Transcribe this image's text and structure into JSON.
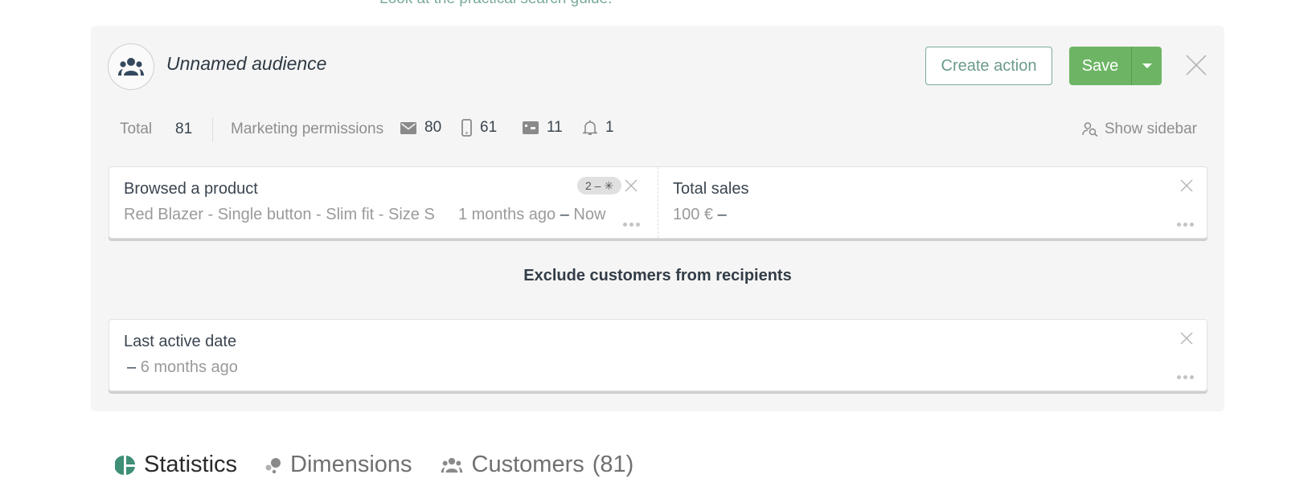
{
  "top_link": "Look at the practical search guide.",
  "header": {
    "title": "Unnamed audience",
    "avatar_icon": "group-icon",
    "create_action_label": "Create action",
    "save_label": "Save"
  },
  "stats": {
    "total_label": "Total",
    "total_value": "81",
    "permissions_label": "Marketing permissions",
    "permissions": [
      {
        "icon": "email-icon",
        "value": "80"
      },
      {
        "icon": "mobile-icon",
        "value": "61"
      },
      {
        "icon": "mailbox-icon",
        "value": "11"
      },
      {
        "icon": "bell-icon",
        "value": "1"
      }
    ],
    "show_sidebar_label": "Show sidebar"
  },
  "include_conditions": [
    {
      "title": "Browsed a product",
      "detail": "Red Blazer - Single button - Slim fit - Size S",
      "range_from": "1 months ago",
      "range_to": "Now",
      "badge": "2 – ✳"
    },
    {
      "title": "Total sales",
      "range_from": "100 €",
      "range_to": ""
    }
  ],
  "exclude_heading": "Exclude customers from recipients",
  "exclude_conditions": [
    {
      "title": "Last active date",
      "range_from": "",
      "range_to": "6 months ago"
    }
  ],
  "tabs": [
    {
      "label": "Statistics",
      "icon": "pie-chart-icon",
      "active": true
    },
    {
      "label": "Dimensions",
      "icon": "bubbles-icon",
      "active": false
    },
    {
      "label": "Customers",
      "count": "(81)",
      "icon": "group-icon",
      "active": false
    }
  ],
  "colors": {
    "accent_green": "#6db565",
    "outline_teal": "#7aaa9a",
    "tab_icon_green": "#3f8f77"
  }
}
